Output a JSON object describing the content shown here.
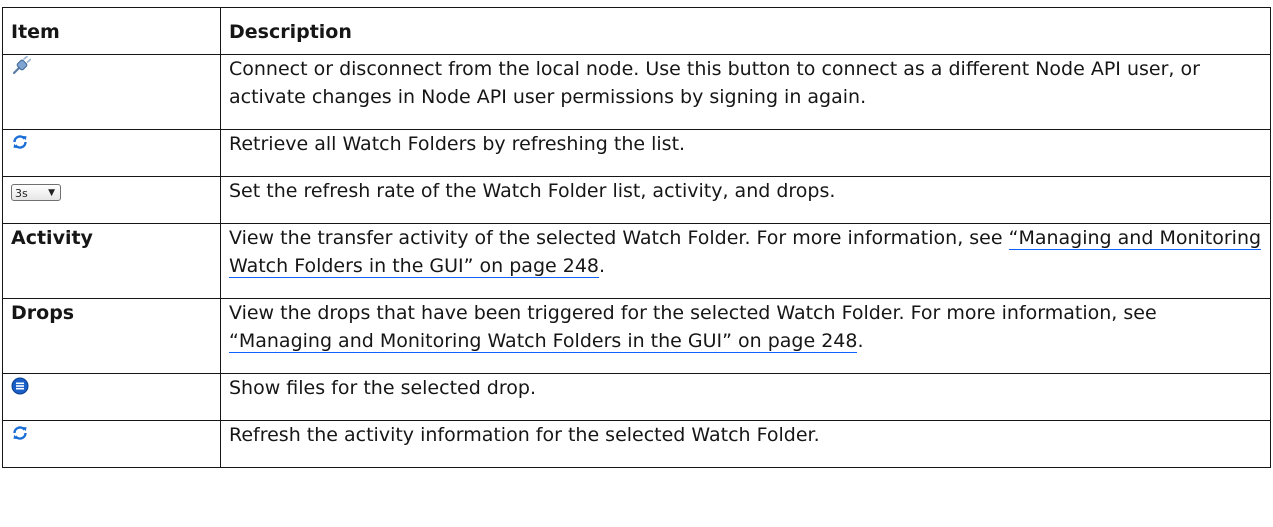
{
  "table": {
    "header": {
      "item": "Item",
      "description": "Description"
    },
    "rows": [
      {
        "item_icon": "connect-plug-icon",
        "description": "Connect or disconnect from the local node. Use this button to connect as a different Node API user, or activate changes in Node API user permissions by signing in again."
      },
      {
        "item_icon": "refresh-icon",
        "description": "Retrieve all Watch Folders by refreshing the list."
      },
      {
        "item_icon": "refresh-rate-dropdown",
        "item_value": "3s",
        "description": "Set the refresh rate of the Watch Folder list, activity, and drops."
      },
      {
        "item": "Activity",
        "description": "View the transfer activity of the selected Watch Folder. For more information, see",
        "link": "“Managing and Monitoring Watch Folders in the GUI” on page 248",
        "link_suffix": "."
      },
      {
        "item": "Drops",
        "description": "View the drops that have been triggered for the selected Watch Folder. For more information, see",
        "link": "“Managing and Monitoring Watch Folders in the GUI” on page 248",
        "link_suffix": "."
      },
      {
        "item_icon": "show-files-list-icon",
        "description": "Show files for the selected drop."
      },
      {
        "item_icon": "refresh-icon",
        "description": "Refresh the activity information for the selected Watch Folder."
      }
    ]
  },
  "colors": {
    "border": "#161616",
    "link_underline": "#0f62fe",
    "icon_blue": "#1a6fd6"
  }
}
